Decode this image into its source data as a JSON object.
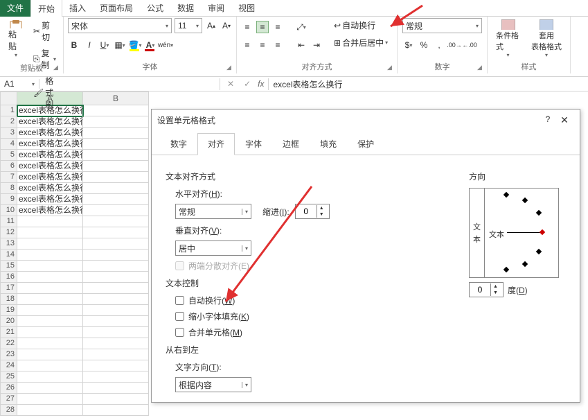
{
  "tabs": {
    "file": "文件",
    "home": "开始",
    "insert": "插入",
    "layout": "页面布局",
    "formula": "公式",
    "data": "数据",
    "review": "审阅",
    "view": "视图"
  },
  "clipboard": {
    "cut": "剪切",
    "copy": "复制",
    "painter": "格式刷",
    "paste": "粘贴",
    "group": "剪贴板"
  },
  "font": {
    "name": "宋体",
    "size": "11",
    "group": "字体"
  },
  "align": {
    "wrap": "自动换行",
    "merge": "合并后居中",
    "group": "对齐方式"
  },
  "number": {
    "format": "常规",
    "group": "数字"
  },
  "styles": {
    "cond": "条件格式",
    "table": "套用\n表格格式",
    "group": "样式"
  },
  "namebox": "A1",
  "formula_value": "excel表格怎么换行",
  "cols": [
    "A",
    "B"
  ],
  "rowdata": [
    "excel表格怎么换行",
    "excel表格怎么换行",
    "excel表格怎么换行",
    "excel表格怎么换行",
    "excel表格怎么换行",
    "excel表格怎么换行",
    "excel表格怎么换行",
    "excel表格怎么换行",
    "excel表格怎么换行",
    "excel表格怎么换行"
  ],
  "total_rows": 28,
  "dlg": {
    "title": "设置单元格格式",
    "tabs": [
      "数字",
      "对齐",
      "字体",
      "边框",
      "填充",
      "保护"
    ],
    "text_align": "文本对齐方式",
    "h_label": "水平对齐(H):",
    "h_value": "常规",
    "indent_label": "缩进(I):",
    "indent_value": "0",
    "v_label": "垂直对齐(V):",
    "v_value": "居中",
    "justify_dist": "两端分散对齐(E)",
    "text_ctrl": "文本控制",
    "wrap": "自动换行(W)",
    "shrink": "缩小字体填充(K)",
    "merge": "合并单元格(M)",
    "rtl": "从右到左",
    "dir_label": "文字方向(T):",
    "dir_value": "根据内容",
    "orient": "方向",
    "orient_v": "文本",
    "orient_h": "文本",
    "deg_value": "0",
    "deg_label": "度(D)"
  }
}
